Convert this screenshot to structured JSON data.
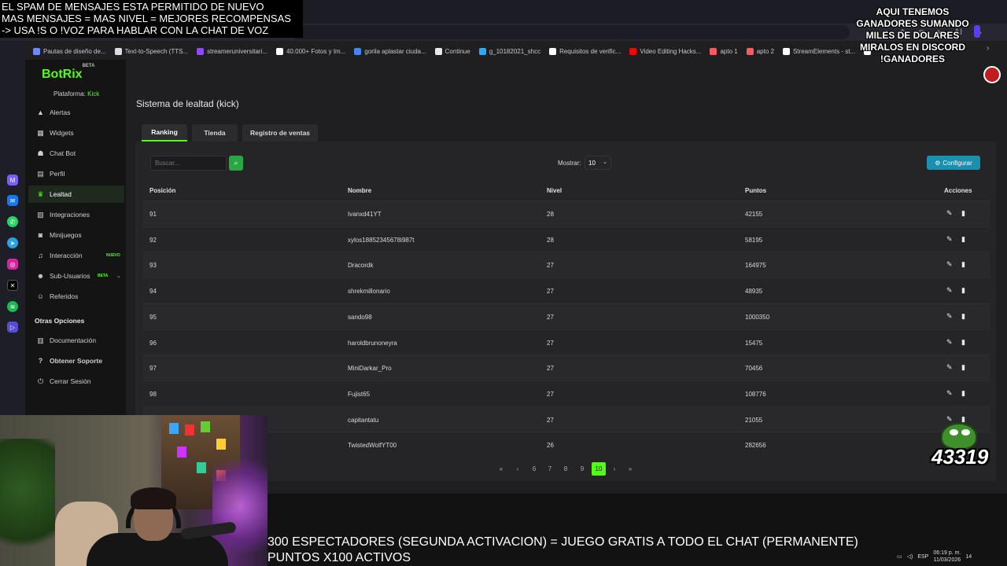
{
  "overlay": {
    "top_lines": [
      "EL SPAM DE MENSAJES ESTA PERMITIDO DE NUEVO",
      "MAS MENSAJES = MAS NIVEL = MEJORES RECOMPENSAS",
      "-> USA !S O !VOZ PARA HABLAR CON LA CHAT DE VOZ"
    ],
    "right_lines": [
      "AQUI TENEMOS",
      "GANADORES SUMANDO",
      "MILES DE DOLARES",
      "MIRALOS EN DISCORD",
      "!GANADORES"
    ],
    "bottom_lines": [
      "300 ESPECTADORES (SEGUNDA ACTIVACION) = JUEGO GRATIS A TODO EL CHAT (PERMANENTE)",
      "PUNTOS X100 ACTIVOS"
    ],
    "counter": "43319"
  },
  "browser": {
    "bookmarks": [
      {
        "label": "Pautas de diseño de...",
        "color": "#6b8cff"
      },
      {
        "label": "Text-to-Speech (TTS...",
        "color": "#dddddd"
      },
      {
        "label": "streameruniversitari...",
        "color": "#9146ff"
      },
      {
        "label": "40.000+ Fotos y Im...",
        "color": "#ffffff"
      },
      {
        "label": "gorila aplastar ciuda...",
        "color": "#4285f4"
      },
      {
        "label": "Continue",
        "color": "#e8e8e8"
      },
      {
        "label": "g_10182021_shcc",
        "color": "#2ba8ff"
      },
      {
        "label": "Requisitos de verific...",
        "color": "#ffffff"
      },
      {
        "label": "Video Editing Hacks...",
        "color": "#ff0000"
      },
      {
        "label": "apto 1",
        "color": "#ff5a5f"
      },
      {
        "label": "apto 2",
        "color": "#ff5a5f"
      },
      {
        "label": "StreamElements - st...",
        "color": "#ffffff"
      },
      {
        "label": "",
        "color": "#ffffff"
      }
    ],
    "ai_label": "AI"
  },
  "app": {
    "logo": "BotRix",
    "logo_badge": "BETA",
    "platform_label": "Plataforma:",
    "platform_value": "Kick",
    "nav": [
      {
        "label": "Alertas",
        "icon": "warning-icon"
      },
      {
        "label": "Widgets",
        "icon": "widget-icon"
      },
      {
        "label": "Chat Bot",
        "icon": "robot-icon"
      },
      {
        "label": "Perfil",
        "icon": "profile-icon"
      },
      {
        "label": "Lealtad",
        "icon": "trophy-icon"
      },
      {
        "label": "Integraciones",
        "icon": "grid-icon"
      },
      {
        "label": "Minijuegos",
        "icon": "gamepad-icon"
      },
      {
        "label": "Interacción",
        "icon": "music-icon"
      },
      {
        "label": "Sub-Usuarios",
        "icon": "users-icon"
      },
      {
        "label": "Referidos",
        "icon": "referral-icon"
      }
    ],
    "nav_badge_new": "NUEVO",
    "nav_badge_beta": "BETA",
    "otras_title": "Otras Opciones",
    "otras": [
      {
        "label": "Documentación",
        "icon": "book-icon"
      },
      {
        "label": "Obtener Soporte",
        "icon": "help-icon"
      },
      {
        "label": "Cerrar Sesión",
        "icon": "logout-icon"
      }
    ]
  },
  "page": {
    "title": "Sistema de lealtad (kick)",
    "tabs": [
      "Ranking",
      "Tienda",
      "Registro de ventas"
    ],
    "search_placeholder": "Buscar...",
    "mostrar_label": "Mostrar:",
    "mostrar_value": "10",
    "config_label": "Configurar",
    "columns": [
      "Posición",
      "Nombre",
      "Nivel",
      "Puntos",
      "Acciones"
    ],
    "rows": [
      {
        "pos": "91",
        "name": "Ivanxd41YT",
        "level": "28",
        "points": "42155"
      },
      {
        "pos": "92",
        "name": "xylos18852345678i987t",
        "level": "28",
        "points": "58195"
      },
      {
        "pos": "93",
        "name": "Dracordk",
        "level": "27",
        "points": "164975"
      },
      {
        "pos": "94",
        "name": "shrekmillonario",
        "level": "27",
        "points": "48935"
      },
      {
        "pos": "95",
        "name": "sando98",
        "level": "27",
        "points": "1000350"
      },
      {
        "pos": "96",
        "name": "haroldbrunoneyra",
        "level": "27",
        "points": "15475"
      },
      {
        "pos": "97",
        "name": "MiniDarkar_Pro",
        "level": "27",
        "points": "70456"
      },
      {
        "pos": "98",
        "name": "Fujist65",
        "level": "27",
        "points": "108776"
      },
      {
        "pos": "",
        "name": "capitantatu",
        "level": "27",
        "points": "21055"
      },
      {
        "pos": "",
        "name": "TwistedWolfYT00",
        "level": "26",
        "points": "282656"
      }
    ],
    "pagination": [
      "«",
      "‹",
      "6",
      "7",
      "8",
      "9",
      "10",
      "›",
      "»"
    ],
    "pagination_active": "10"
  },
  "taskbar": {
    "lang": "ESP",
    "time": "06:19 p. m.",
    "date": "11/03/2026",
    "notif": "14"
  }
}
